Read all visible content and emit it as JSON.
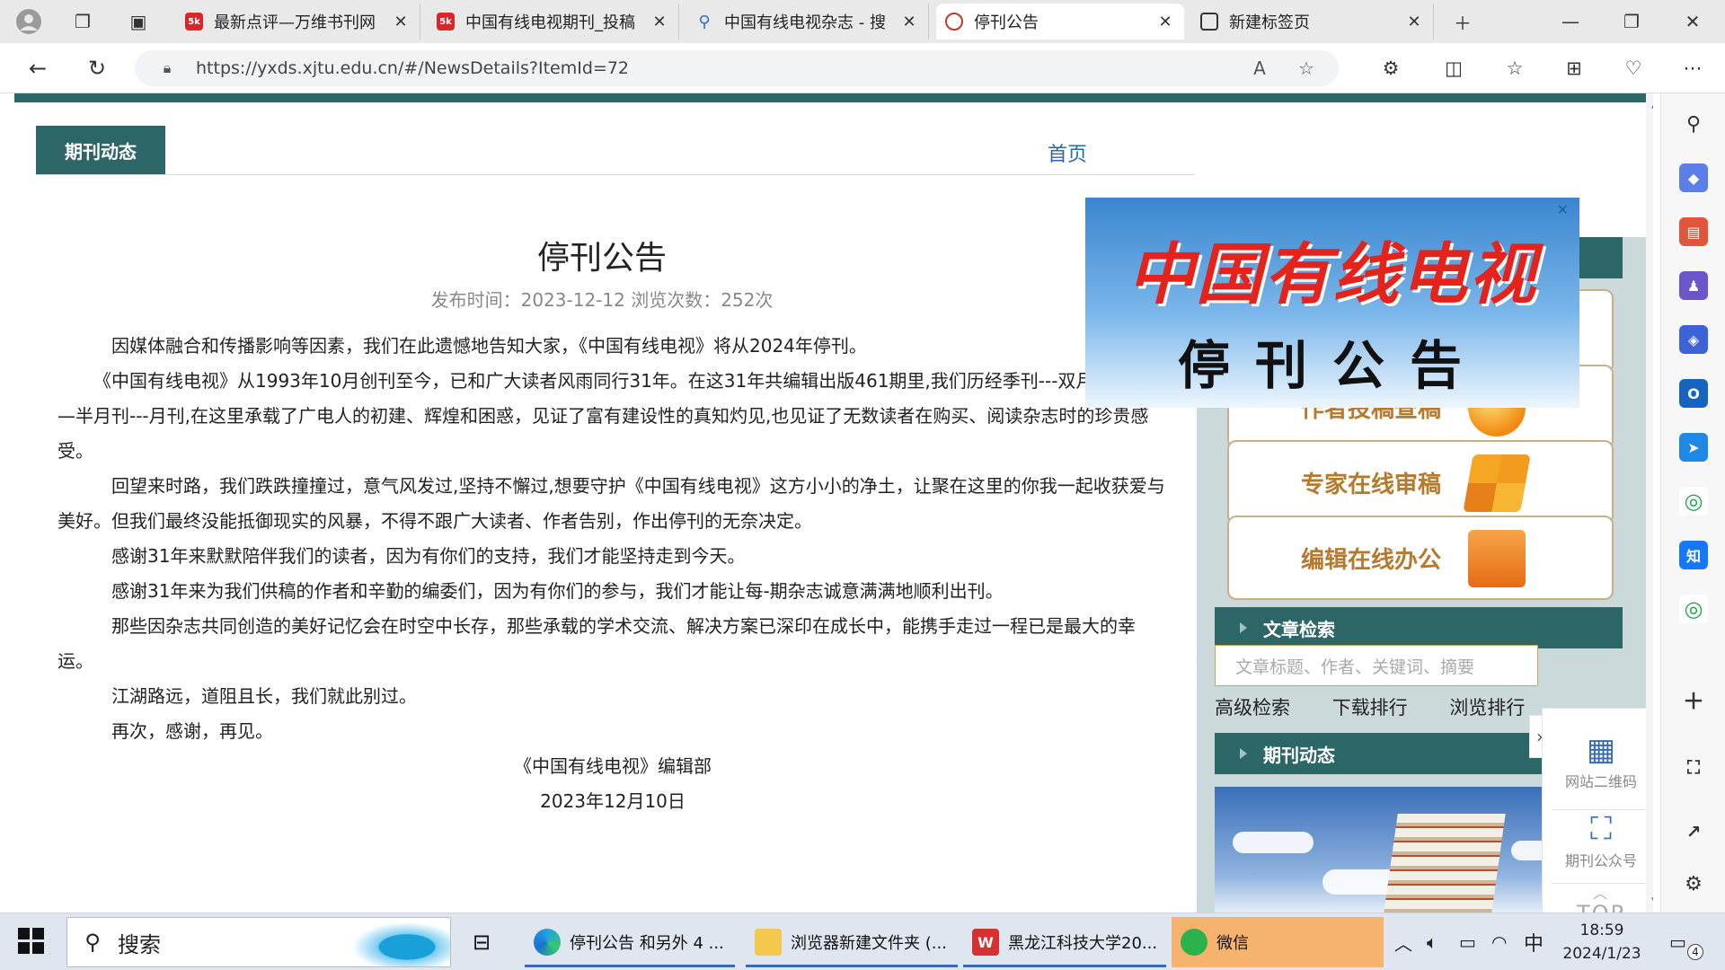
{
  "browser": {
    "tabs": [
      {
        "title": "最新点评—万维书刊网",
        "active": false
      },
      {
        "title": "中国有线电视期刊_投稿",
        "active": false
      },
      {
        "title": "中国有线电视杂志 - 搜",
        "active": false
      },
      {
        "title": "停刊公告",
        "active": true
      },
      {
        "title": "新建标签页",
        "active": false
      }
    ],
    "url": "https://yxds.xjtu.edu.cn/#/NewsDetails?ItemId=72"
  },
  "page": {
    "column_tab": "期刊动态",
    "breadcrumb": "首页",
    "article": {
      "title": "停刊公告",
      "meta": "发布时间：2023-12-12  浏览次数：252次",
      "paragraphs": [
        "因媒体融合和传播影响等因素，我们在此遗憾地告知大家，《中国有线电视》将从2024年停刊。",
        "《中国有线电视》从1993年10月创刊至今，已和广大读者风雨同行31年。在这31年共编辑出版461期里,我们历经季刊---双月刊---月刊—半月刊---月刊,在这里承载了广电人的初建、辉煌和困惑，见证了富有建设性的真知灼见,也见证了无数读者在购买、阅读杂志时的珍贵感受。",
        "回望来时路，我们跌跌撞撞过，意气风发过,坚持不懈过,想要守护《中国有线电视》这方小小的净土，让聚在这里的你我一起收获爱与美好。但我们最终没能抵御现实的风暴，不得不跟广大读者、作者告别，作出停刊的无奈决定。",
        "感谢31年来默默陪伴我们的读者，因为有你们的支持，我们才能坚持走到今天。",
        "感谢31年来为我们供稿的作者和辛勤的编委们，因为有你们的参与，我们才能让每-期杂志诚意满满地顺利出刊。",
        "那些因杂志共同创造的美好记忆会在时空中长存，那些承载的学术交流、解决方案已深印在成长中，能携手走过一程已是最大的幸运。",
        "江湖路远，道阻且长，我们就此别过。",
        "再次，感谢，再见。"
      ],
      "signature": "《中国有线电视》编辑部",
      "date": "2023年12月10日"
    },
    "popup": {
      "headline": "中国有线电视",
      "subline": "停刊公告"
    },
    "sidebar": {
      "cards": [
        {
          "label": "作者投稿查稿"
        },
        {
          "label": "专家在线审稿"
        },
        {
          "label": "编辑在线办公"
        }
      ],
      "search_title": "文章检索",
      "search_placeholder": "文章标题、作者、关键词、摘要",
      "search_links": [
        "高级检索",
        "下载排行",
        "浏览排行"
      ],
      "news_title": "期刊动态"
    },
    "float_widget": {
      "qr_label": "网站二维码",
      "wechat_label": "期刊公众号",
      "top_label": "TOP"
    }
  },
  "taskbar": {
    "search_text": "搜索",
    "apps": [
      {
        "label": "停刊公告 和另外 4 ..."
      },
      {
        "label": "浏览器新建文件夹 (..."
      },
      {
        "label": "黑龙江科技大学20..."
      },
      {
        "label": "微信"
      }
    ],
    "ime": "中",
    "time": "18:59",
    "date": "2024/1/23",
    "notif_count": "4"
  },
  "colors": {
    "teal": "#2d6667",
    "side_bg": "#cbd9da",
    "card_text": "#b67a2e",
    "popup_red": "#e5231d"
  }
}
